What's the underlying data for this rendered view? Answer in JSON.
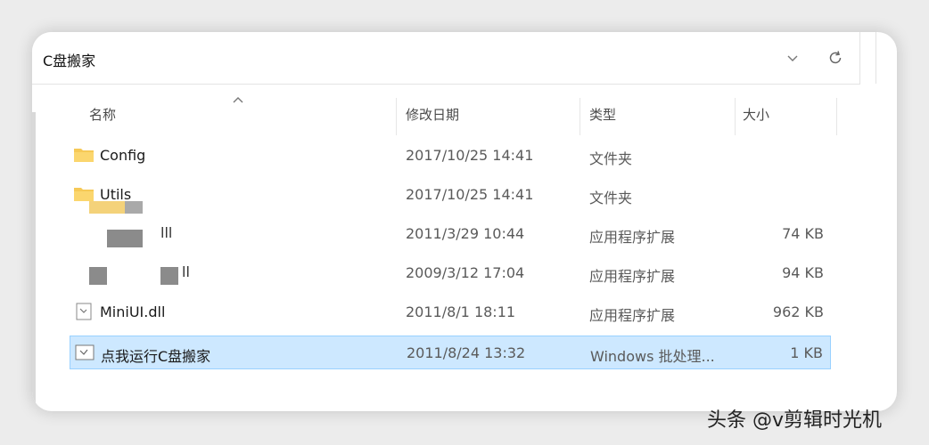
{
  "address": {
    "path": "C盘搬家"
  },
  "columns": {
    "name": "名称",
    "date": "修改日期",
    "type": "类型",
    "size": "大小"
  },
  "files": [
    {
      "name": "Config",
      "date": "2017/10/25 14:41",
      "type": "文件夹",
      "size": "",
      "icon": "folder-icon"
    },
    {
      "name": "Utils",
      "date": "2017/10/25 14:41",
      "type": "文件夹",
      "size": "",
      "icon": "folder-icon"
    },
    {
      "name": "lll",
      "date": "2011/3/29 10:44",
      "type": "应用程序扩展",
      "size": "74 KB",
      "icon": "dll-icon"
    },
    {
      "name": "ll",
      "date": "2009/3/12 17:04",
      "type": "应用程序扩展",
      "size": "94 KB",
      "icon": "dll-icon"
    },
    {
      "name": "MiniUI.dll",
      "date": "2011/8/1 18:11",
      "type": "应用程序扩展",
      "size": "962 KB",
      "icon": "dll-icon"
    },
    {
      "name": "点我运行C盘搬家",
      "date": "2011/8/24 13:32",
      "type": "Windows 批处理...",
      "size": "1 KB",
      "icon": "batch-file-icon"
    }
  ],
  "watermark": "头条 @v剪辑时光机",
  "colors": {
    "selection": "#cde8ff",
    "selection_border": "#99d1ff",
    "folder": "#f6c956"
  }
}
